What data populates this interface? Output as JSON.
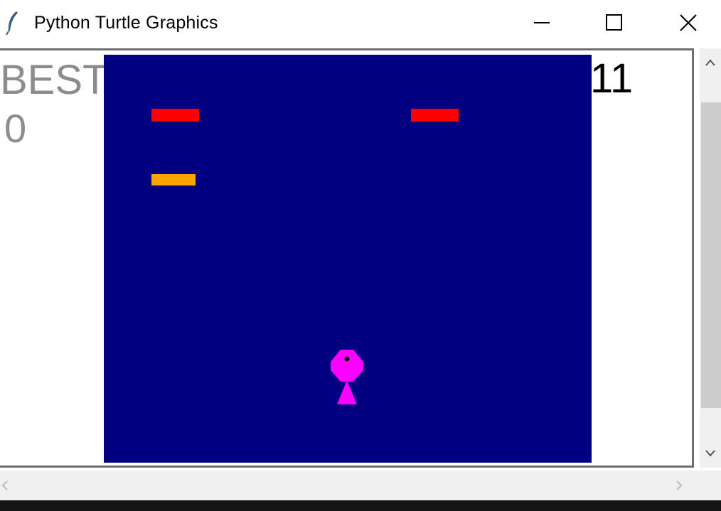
{
  "window": {
    "title": "Python Turtle Graphics",
    "icon": "feather-icon"
  },
  "title_bar_buttons": {
    "minimize": "minimize-icon",
    "maximize": "maximize-icon",
    "close": "close-icon"
  },
  "game": {
    "best_label": "BEST",
    "best_value": "0",
    "score": "11",
    "colors": {
      "playfield": "#000080",
      "brick_red": "#ff0000",
      "brick_orange": "#ffa500",
      "player": "#ff00ff",
      "label_gray": "#8c8c8c",
      "score_text": "#000000"
    },
    "bricks": [
      {
        "color": "red"
      },
      {
        "color": "red"
      },
      {
        "color": "orange"
      }
    ],
    "player": {
      "shape": "circle-with-triangle",
      "color": "magenta"
    }
  },
  "scrollbars": {
    "vertical": {
      "up": "chevron-up-icon",
      "down": "chevron-down-icon"
    },
    "horizontal": {
      "left": "chevron-left-icon",
      "right": "chevron-right-icon"
    }
  }
}
